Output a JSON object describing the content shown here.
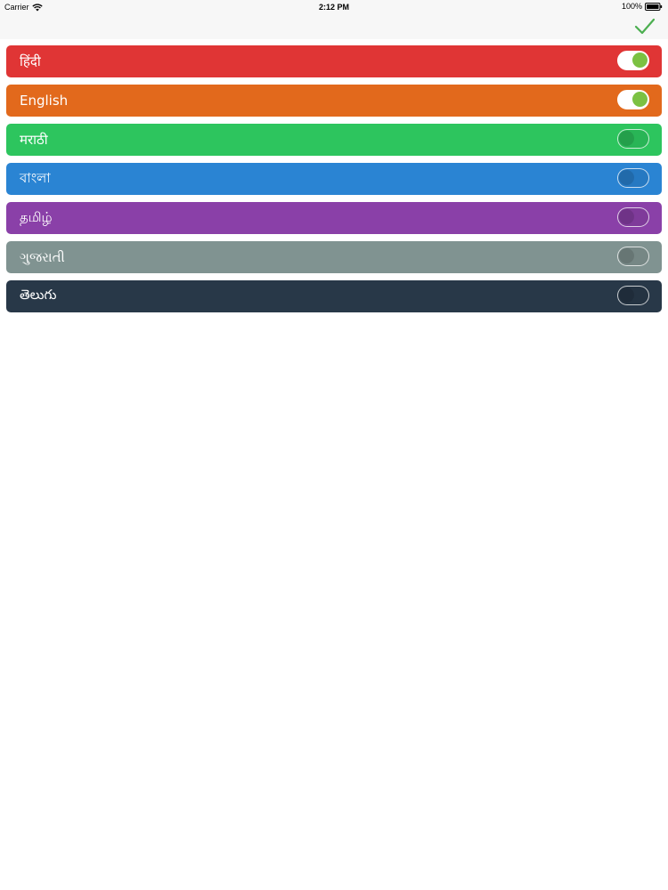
{
  "status_bar": {
    "carrier": "Carrier",
    "time": "2:12 PM",
    "battery": "100%"
  },
  "toolbar": {
    "done_icon": "checkmark-icon",
    "done_color": "#4caf50"
  },
  "languages": [
    {
      "label": "हिंदी",
      "color": "#e03535",
      "enabled": true
    },
    {
      "label": "English",
      "color": "#e2691c",
      "enabled": true
    },
    {
      "label": "मराठी",
      "color": "#2dc55e",
      "enabled": false
    },
    {
      "label": "বাংলা",
      "color": "#2a84d3",
      "enabled": false
    },
    {
      "label": "தமிழ்",
      "color": "#8a40a8",
      "enabled": false
    },
    {
      "label": "ગુજરાતી",
      "color": "#809391",
      "enabled": false
    },
    {
      "label": "తెలుగు",
      "color": "#283848",
      "enabled": false
    }
  ],
  "toggle_on_color": "#7bc142"
}
